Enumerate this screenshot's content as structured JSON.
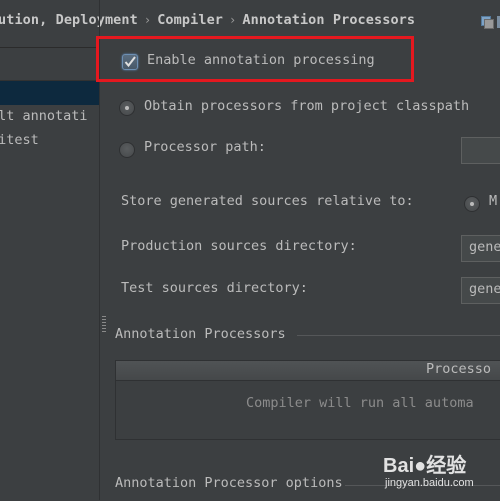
{
  "breadcrumb": {
    "items": [
      "ution, Deployment",
      "Compiler",
      "Annotation Processors"
    ],
    "separator": "›"
  },
  "header_icons": [
    "copy-settings-icon"
  ],
  "sidebar": {
    "items": [
      {
        "label": "ult annotati",
        "selected": false
      },
      {
        "label": "pitest",
        "selected": false
      }
    ]
  },
  "main": {
    "enable_checkbox": {
      "label": "Enable annotation processing",
      "checked": true
    },
    "obtain_radio": {
      "label": "Obtain processors from project classpath",
      "selected": true
    },
    "processor_path_radio": {
      "label": "Processor path:",
      "selected": false
    },
    "processor_path_value": "",
    "store_label": "Store generated sources relative to:",
    "store_option": {
      "label": "M",
      "selected": true
    },
    "production_label": "Production sources directory:",
    "production_value": "gene",
    "test_label": "Test sources directory:",
    "test_value": "gene",
    "processors_section": "Annotation Processors",
    "table_header": "Processo",
    "table_empty": "Compiler will run all automa",
    "options_section": "Annotation Processor options"
  },
  "watermark": {
    "brand": "Bai●经验",
    "url": "jingyan.baidu.com"
  },
  "colors": {
    "highlight": "#e5181f",
    "selection": "#0d293e",
    "background": "#3c3f41"
  }
}
